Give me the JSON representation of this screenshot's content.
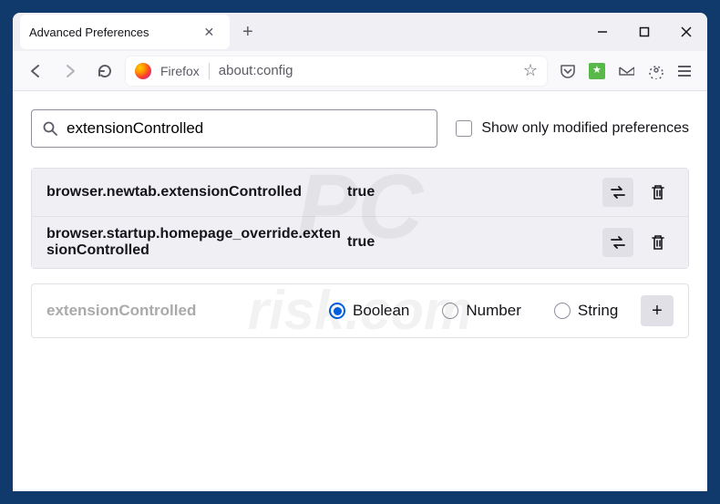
{
  "tab": {
    "title": "Advanced Preferences"
  },
  "urlbar": {
    "product": "Firefox",
    "url": "about:config"
  },
  "search": {
    "value": "extensionControlled",
    "only_modified_label": "Show only modified preferences"
  },
  "prefs": [
    {
      "name": "browser.newtab.extensionControlled",
      "value": "true"
    },
    {
      "name": "browser.startup.homepage_override.extensionControlled",
      "value": "true"
    }
  ],
  "new_pref": {
    "name": "extensionControlled",
    "types": [
      "Boolean",
      "Number",
      "String"
    ],
    "selected_index": 0
  }
}
